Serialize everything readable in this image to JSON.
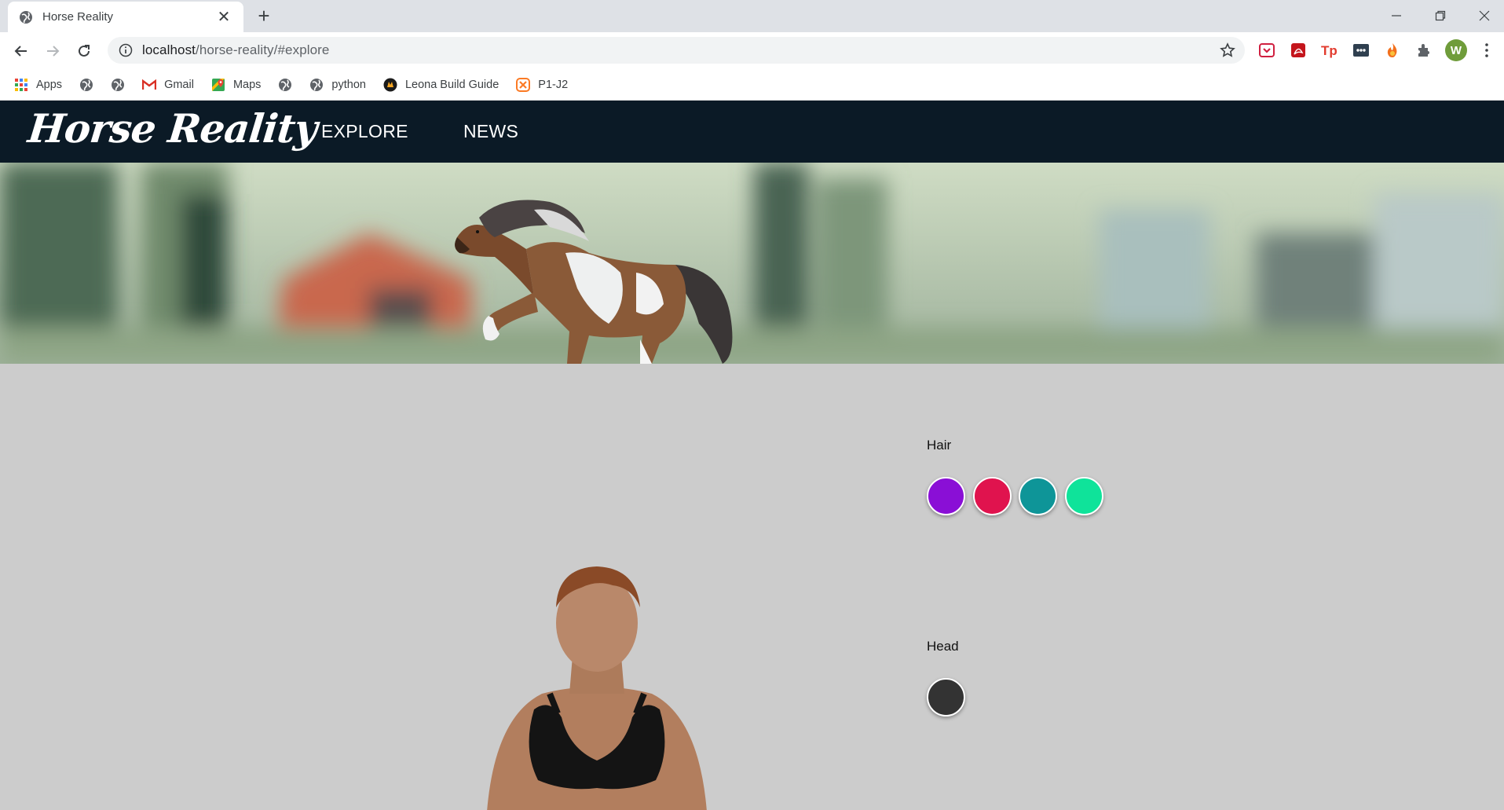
{
  "browser": {
    "tab_title": "Horse Reality",
    "url_host": "localhost",
    "url_path": "/horse-reality/#explore",
    "avatar_letter": "W",
    "bookmarks": [
      {
        "label": "Apps",
        "icon": "apps-grid-icon"
      },
      {
        "label": "",
        "icon": "globe-icon"
      },
      {
        "label": "",
        "icon": "globe-icon"
      },
      {
        "label": "Gmail",
        "icon": "gmail-icon"
      },
      {
        "label": "Maps",
        "icon": "maps-icon"
      },
      {
        "label": "",
        "icon": "globe-icon"
      },
      {
        "label": "python",
        "icon": "globe-icon"
      },
      {
        "label": "Leona Build Guide",
        "icon": "leona-icon"
      },
      {
        "label": "P1-J2",
        "icon": "xampp-icon"
      }
    ]
  },
  "site": {
    "logo": "Horse Reality",
    "nav": {
      "explore": "EXPLORE",
      "news": "NEWS"
    }
  },
  "customizer": {
    "hair": {
      "label": "Hair",
      "colors": [
        "#8a0fd6",
        "#e0134e",
        "#0e9598",
        "#0fe39a"
      ]
    },
    "head": {
      "label": "Head",
      "colors": [
        "#333333"
      ]
    }
  }
}
